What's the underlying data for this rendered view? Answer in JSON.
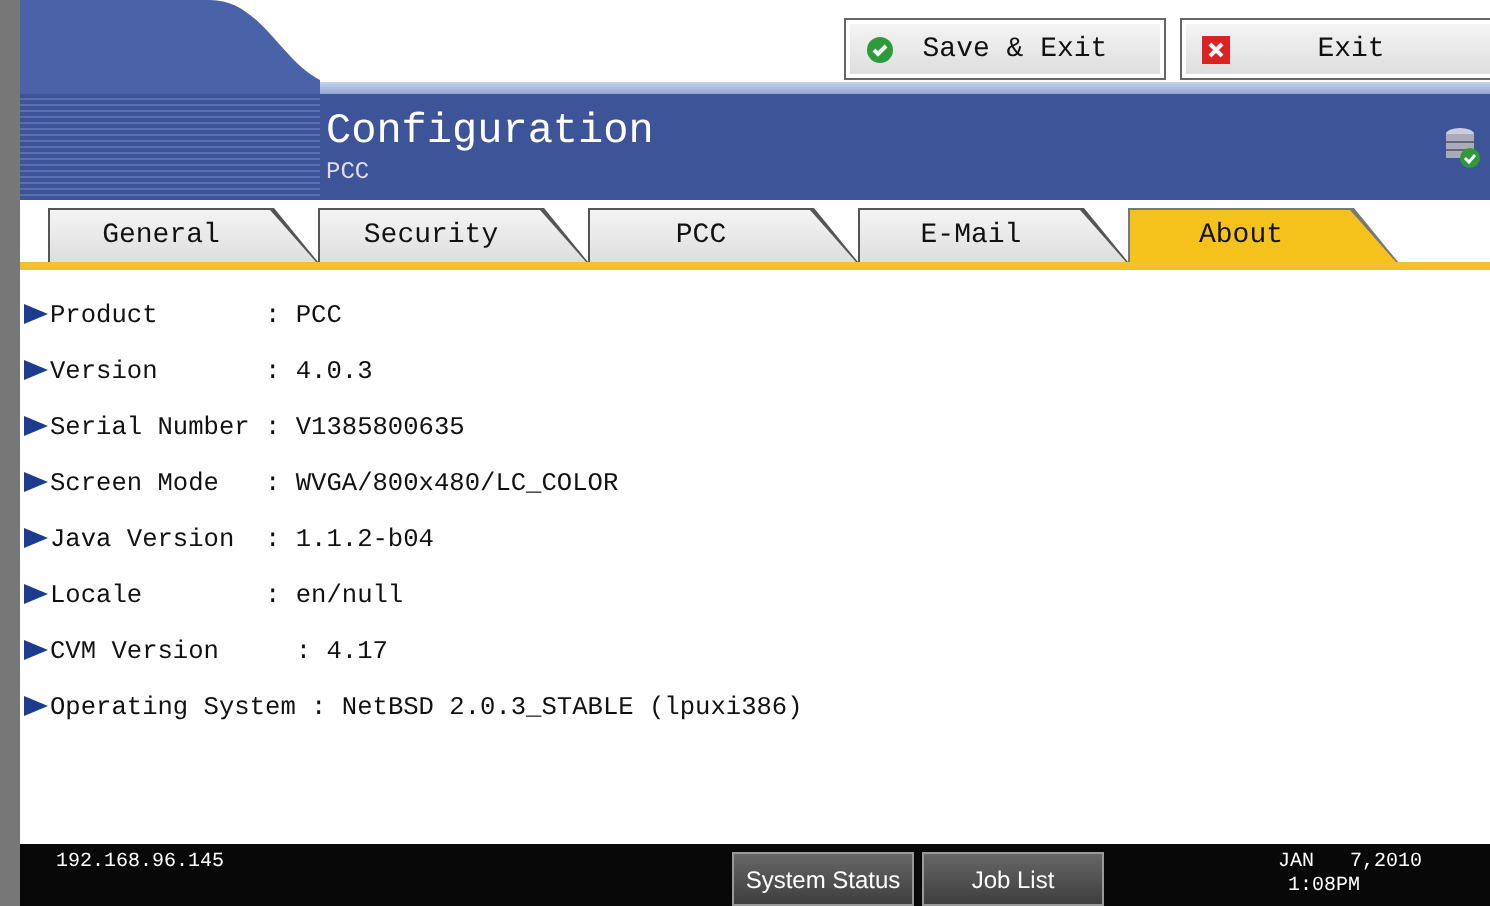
{
  "header_buttons": [
    {
      "kind": "save",
      "label": "Save & Exit"
    },
    {
      "kind": "exit",
      "label": "Exit"
    }
  ],
  "banner": {
    "title": "Configuration",
    "subtitle": "PCC"
  },
  "tabs": [
    {
      "label": "General",
      "selected": false
    },
    {
      "label": "Security",
      "selected": false
    },
    {
      "label": "PCC",
      "selected": false
    },
    {
      "label": "E-Mail",
      "selected": false
    },
    {
      "label": "About",
      "selected": true
    }
  ],
  "info": [
    {
      "label": "Product",
      "value": ": PCC"
    },
    {
      "label": "Version",
      "value": ": 4.0.3"
    },
    {
      "label": "Serial Number",
      "value": ": V1385800635"
    },
    {
      "label": "Screen Mode",
      "value": ": WVGA/800x480/LC_COLOR"
    },
    {
      "label": "Java Version",
      "value": ": 1.1.2-b04"
    },
    {
      "label": "Locale",
      "value": ": en/null"
    },
    {
      "label": "CVM Version",
      "value": "  : 4.17"
    },
    {
      "label": "Operating System",
      "value": ": NetBSD 2.0.3_STABLE (lpuxi386)"
    }
  ],
  "status_bar": {
    "ip": "192.168.96.145",
    "buttons": [
      "System Status",
      "Job List"
    ],
    "date": "JAN   7,2010",
    "time": "1:08PM"
  }
}
